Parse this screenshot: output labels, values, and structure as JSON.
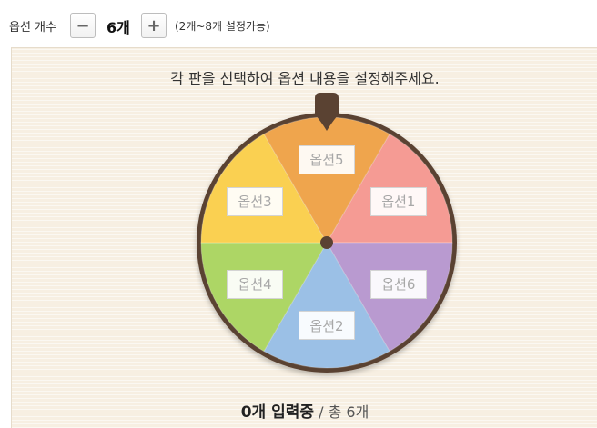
{
  "toolbar": {
    "option_count_label": "옵션 개수",
    "minus_symbol": "−",
    "count_value": "6",
    "count_unit": "개",
    "plus_symbol": "+",
    "range_hint": "(2개~8개 설정가능)"
  },
  "board": {
    "instruction": "각 판을 선택하여 옵션 내용을 설정해주세요."
  },
  "wheel": {
    "slices": [
      {
        "label": "옵션1",
        "color": "#f59b94"
      },
      {
        "label": "옵션6",
        "color": "#b99ad0"
      },
      {
        "label": "옵션2",
        "color": "#9bc0e6"
      },
      {
        "label": "옵션4",
        "color": "#add665"
      },
      {
        "label": "옵션3",
        "color": "#fad051"
      },
      {
        "label": "옵션5",
        "color": "#efa54d"
      }
    ],
    "rim_color": "#5a4232",
    "pointer_color": "#5a4232"
  },
  "footer": {
    "entered": "0개 입력중",
    "total": " / 총 6개"
  }
}
